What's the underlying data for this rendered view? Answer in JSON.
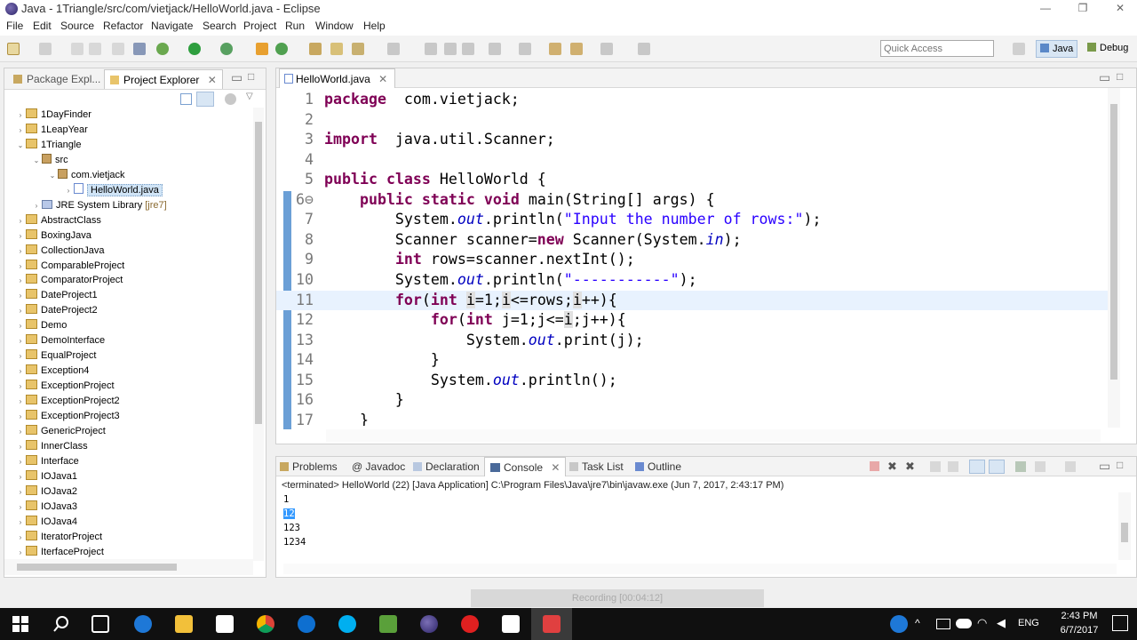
{
  "window": {
    "title": "Java - 1Triangle/src/com/vietjack/HelloWorld.java - Eclipse",
    "controls": [
      "—",
      "❐",
      "✕"
    ]
  },
  "menubar": [
    "File",
    "Edit",
    "Source",
    "Refactor",
    "Navigate",
    "Search",
    "Project",
    "Run",
    "Window",
    "Help"
  ],
  "toolbar": {
    "quick_access_placeholder": "Quick Access",
    "perspectives": [
      "Java",
      "Debug"
    ]
  },
  "left_panel": {
    "tabs": [
      "Package Expl...",
      "Project Explorer"
    ],
    "tree": [
      {
        "label": "1DayFinder",
        "indent": 0,
        "twisty": "›",
        "icon": "project"
      },
      {
        "label": "1LeapYear",
        "indent": 0,
        "twisty": "›",
        "icon": "project"
      },
      {
        "label": "1Triangle",
        "indent": 0,
        "twisty": "⌄",
        "icon": "project"
      },
      {
        "label": "src",
        "indent": 1,
        "twisty": "⌄",
        "icon": "package-folder"
      },
      {
        "label": "com.vietjack",
        "indent": 2,
        "twisty": "⌄",
        "icon": "package"
      },
      {
        "label": "HelloWorld.java",
        "indent": 3,
        "twisty": "›",
        "icon": "java-file",
        "selected": true
      },
      {
        "label": "JRE System Library",
        "suffix": "[jre7]",
        "indent": 1,
        "twisty": "›",
        "icon": "library"
      },
      {
        "label": "AbstractClass",
        "indent": 0,
        "twisty": "›",
        "icon": "project"
      },
      {
        "label": "BoxingJava",
        "indent": 0,
        "twisty": "›",
        "icon": "project"
      },
      {
        "label": "CollectionJava",
        "indent": 0,
        "twisty": "›",
        "icon": "project"
      },
      {
        "label": "ComparableProject",
        "indent": 0,
        "twisty": "›",
        "icon": "project"
      },
      {
        "label": "ComparatorProject",
        "indent": 0,
        "twisty": "›",
        "icon": "project"
      },
      {
        "label": "DateProject1",
        "indent": 0,
        "twisty": "›",
        "icon": "project"
      },
      {
        "label": "DateProject2",
        "indent": 0,
        "twisty": "›",
        "icon": "project"
      },
      {
        "label": "Demo",
        "indent": 0,
        "twisty": "›",
        "icon": "project"
      },
      {
        "label": "DemoInterface",
        "indent": 0,
        "twisty": "›",
        "icon": "project"
      },
      {
        "label": "EqualProject",
        "indent": 0,
        "twisty": "›",
        "icon": "project"
      },
      {
        "label": "Exception4",
        "indent": 0,
        "twisty": "›",
        "icon": "project"
      },
      {
        "label": "ExceptionProject",
        "indent": 0,
        "twisty": "›",
        "icon": "project"
      },
      {
        "label": "ExceptionProject2",
        "indent": 0,
        "twisty": "›",
        "icon": "project"
      },
      {
        "label": "ExceptionProject3",
        "indent": 0,
        "twisty": "›",
        "icon": "project"
      },
      {
        "label": "GenericProject",
        "indent": 0,
        "twisty": "›",
        "icon": "project"
      },
      {
        "label": "InnerClass",
        "indent": 0,
        "twisty": "›",
        "icon": "project"
      },
      {
        "label": "Interface",
        "indent": 0,
        "twisty": "›",
        "icon": "project"
      },
      {
        "label": "IOJava1",
        "indent": 0,
        "twisty": "›",
        "icon": "project"
      },
      {
        "label": "IOJava2",
        "indent": 0,
        "twisty": "›",
        "icon": "project"
      },
      {
        "label": "IOJava3",
        "indent": 0,
        "twisty": "›",
        "icon": "project"
      },
      {
        "label": "IOJava4",
        "indent": 0,
        "twisty": "›",
        "icon": "project"
      },
      {
        "label": "IteratorProject",
        "indent": 0,
        "twisty": "›",
        "icon": "project"
      },
      {
        "label": "IterfaceProject",
        "indent": 0,
        "twisty": "›",
        "icon": "project"
      }
    ]
  },
  "editor": {
    "tab_label": "HelloWorld.java",
    "lines": [
      {
        "n": "1",
        "segs": [
          [
            "kw",
            "package"
          ],
          [
            "",
            "  com.vietjack;"
          ]
        ]
      },
      {
        "n": "2",
        "segs": []
      },
      {
        "n": "3",
        "segs": [
          [
            "kw",
            "import"
          ],
          [
            "",
            "  java.util.Scanner;"
          ]
        ]
      },
      {
        "n": "4",
        "segs": []
      },
      {
        "n": "5",
        "segs": [
          [
            "kw",
            "public"
          ],
          [
            "",
            " "
          ],
          [
            "kw",
            "class"
          ],
          [
            "",
            " HelloWorld {"
          ]
        ]
      },
      {
        "n": "6⊖",
        "segs": [
          [
            "",
            "    "
          ],
          [
            "kw",
            "public"
          ],
          [
            "",
            " "
          ],
          [
            "kw",
            "static"
          ],
          [
            "",
            " "
          ],
          [
            "kw",
            "void"
          ],
          [
            "",
            " main(String[] args) {"
          ]
        ]
      },
      {
        "n": "7",
        "segs": [
          [
            "",
            "        System."
          ],
          [
            "fld",
            "out"
          ],
          [
            "",
            ".println("
          ],
          [
            "str",
            "\"Input the number of rows:\""
          ],
          [
            "",
            ");"
          ]
        ]
      },
      {
        "n": "8",
        "segs": [
          [
            "",
            "        Scanner scanner="
          ],
          [
            "kw",
            "new"
          ],
          [
            "",
            " Scanner(System."
          ],
          [
            "fld",
            "in"
          ],
          [
            "",
            ");"
          ]
        ]
      },
      {
        "n": "9",
        "segs": [
          [
            "",
            "        "
          ],
          [
            "kw",
            "int"
          ],
          [
            "",
            " rows=scanner.nextInt();"
          ]
        ]
      },
      {
        "n": "10",
        "segs": [
          [
            "",
            "        System."
          ],
          [
            "fld",
            "out"
          ],
          [
            "",
            ".println("
          ],
          [
            "str",
            "\"-----------\""
          ],
          [
            "",
            ");"
          ]
        ]
      },
      {
        "n": "11",
        "segs": [
          [
            "",
            "        "
          ],
          [
            "kw",
            "for"
          ],
          [
            "",
            "("
          ],
          [
            "kw",
            "int"
          ],
          [
            "",
            " "
          ],
          [
            "occ",
            "i"
          ],
          [
            "",
            "=1;"
          ],
          [
            "occ",
            "i"
          ],
          [
            "",
            "<=rows;"
          ],
          [
            "occ",
            "i"
          ],
          [
            "",
            "++){"
          ]
        ],
        "highlight": true
      },
      {
        "n": "12",
        "segs": [
          [
            "",
            "            "
          ],
          [
            "kw",
            "for"
          ],
          [
            "",
            "("
          ],
          [
            "kw",
            "int"
          ],
          [
            "",
            " j=1;j<="
          ],
          [
            "occ",
            "i"
          ],
          [
            "",
            ";j++){"
          ]
        ]
      },
      {
        "n": "13",
        "segs": [
          [
            "",
            "                System."
          ],
          [
            "fld",
            "out"
          ],
          [
            "",
            ".print(j);"
          ]
        ]
      },
      {
        "n": "14",
        "segs": [
          [
            "",
            "            }"
          ]
        ]
      },
      {
        "n": "15",
        "segs": [
          [
            "",
            "            System."
          ],
          [
            "fld",
            "out"
          ],
          [
            "",
            ".println();"
          ]
        ]
      },
      {
        "n": "16",
        "segs": [
          [
            "",
            "        }"
          ]
        ]
      },
      {
        "n": "17",
        "segs": [
          [
            "",
            "    }"
          ]
        ]
      }
    ]
  },
  "console_panel": {
    "tabs": [
      "Problems",
      "@ Javadoc",
      "Declaration",
      "Console",
      "Task List",
      "Outline"
    ],
    "header": "<terminated> HelloWorld (22) [Java Application] C:\\Program Files\\Java\\jre7\\bin\\javaw.exe (Jun 7, 2017, 2:43:17 PM)",
    "output": [
      "1",
      "12",
      "123",
      "1234"
    ]
  },
  "recording_overlay": "Recording [00:04:12]",
  "taskbar": {
    "time": "2:43 PM",
    "date": "6/7/2017",
    "language": "ENG"
  },
  "colors": {
    "keyword": "#7f0055",
    "string": "#2a00ff",
    "field": "#0000c0",
    "selection": "#3399ff",
    "taskbar": "#101010"
  }
}
